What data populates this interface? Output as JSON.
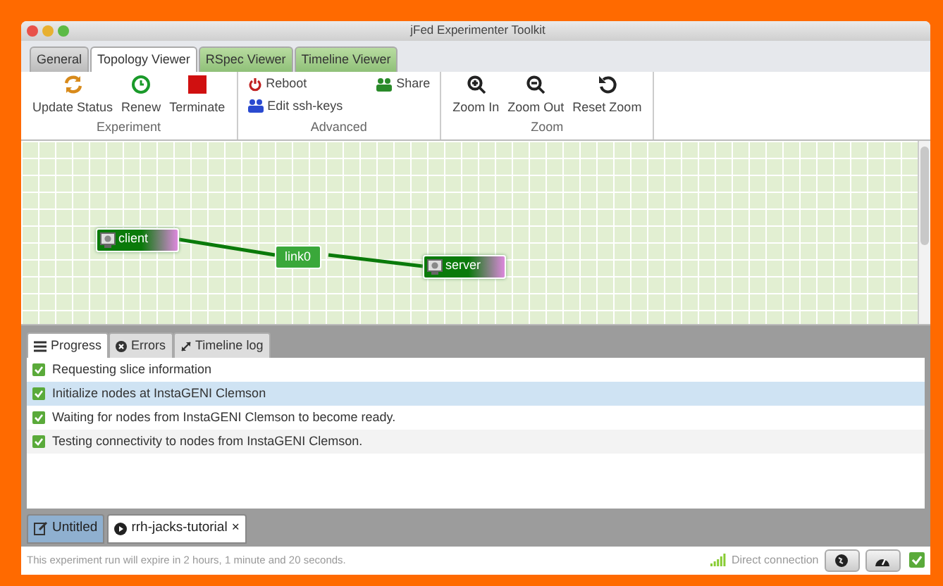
{
  "window": {
    "title": "jFed Experimenter Toolkit"
  },
  "tabs": [
    {
      "label": "General",
      "selected": false,
      "kind": "plain"
    },
    {
      "label": "Topology Viewer",
      "selected": true,
      "kind": "plain"
    },
    {
      "label": "RSpec Viewer",
      "selected": false,
      "kind": "green"
    },
    {
      "label": "Timeline Viewer",
      "selected": false,
      "kind": "green"
    }
  ],
  "ribbon": [
    {
      "title": "Experiment",
      "buttons": [
        {
          "label": "Update Status"
        },
        {
          "label": "Renew"
        },
        {
          "label": "Terminate"
        }
      ]
    },
    {
      "title": "Advanced",
      "buttons": [
        {
          "label": "Reboot"
        },
        {
          "label": "Share"
        },
        {
          "label": "Edit ssh-keys"
        }
      ]
    },
    {
      "title": "Zoom",
      "buttons": [
        {
          "label": "Zoom In"
        },
        {
          "label": "Zoom Out"
        },
        {
          "label": "Reset Zoom"
        }
      ]
    }
  ],
  "topology": {
    "nodes": [
      {
        "label": "client"
      },
      {
        "label": "server"
      }
    ],
    "links": [
      {
        "label": "link0"
      }
    ]
  },
  "panel_tabs": [
    {
      "label": "Progress",
      "selected": true
    },
    {
      "label": "Errors",
      "selected": false
    },
    {
      "label": "Timeline log",
      "selected": false
    }
  ],
  "log": [
    {
      "text": "Requesting slice information",
      "done": true,
      "selected": false
    },
    {
      "text": "Initialize nodes at InstaGENI Clemson",
      "done": true,
      "selected": true
    },
    {
      "text": "Waiting for nodes from InstaGENI Clemson to become ready.",
      "done": true,
      "selected": false
    },
    {
      "text": "Testing connectivity to nodes from InstaGENI Clemson.",
      "done": true,
      "selected": false
    }
  ],
  "documents": [
    {
      "label": "Untitled",
      "selected": false
    },
    {
      "label": "rrh-jacks-tutorial",
      "selected": true,
      "close": "×"
    }
  ],
  "status_bar": {
    "message": "This experiment run will expire in 2 hours, 1 minute and 20 seconds.",
    "connection": "Direct connection"
  }
}
